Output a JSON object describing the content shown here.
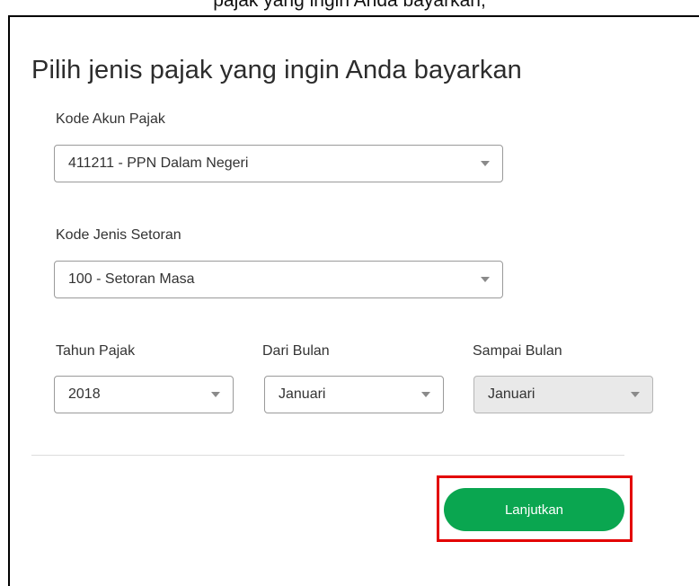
{
  "caption_fragment": "pajak yang ingin Anda bayarkan,",
  "form": {
    "title": "Pilih jenis pajak yang ingin Anda bayarkan",
    "kode_akun_pajak": {
      "label": "Kode Akun Pajak",
      "value": "411211 - PPN Dalam Negeri"
    },
    "kode_jenis_setoran": {
      "label": "Kode Jenis Setoran",
      "value": "100 - Setoran Masa"
    },
    "tahun_pajak": {
      "label": "Tahun Pajak",
      "value": "2018"
    },
    "dari_bulan": {
      "label": "Dari Bulan",
      "value": "Januari"
    },
    "sampai_bulan": {
      "label": "Sampai Bulan",
      "value": "Januari",
      "disabled": true
    },
    "submit_label": "Lanjutkan"
  },
  "colors": {
    "button": "#0aa650",
    "highlight": "#e30000"
  },
  "icons": {
    "dropdown": "caret-down-icon"
  }
}
